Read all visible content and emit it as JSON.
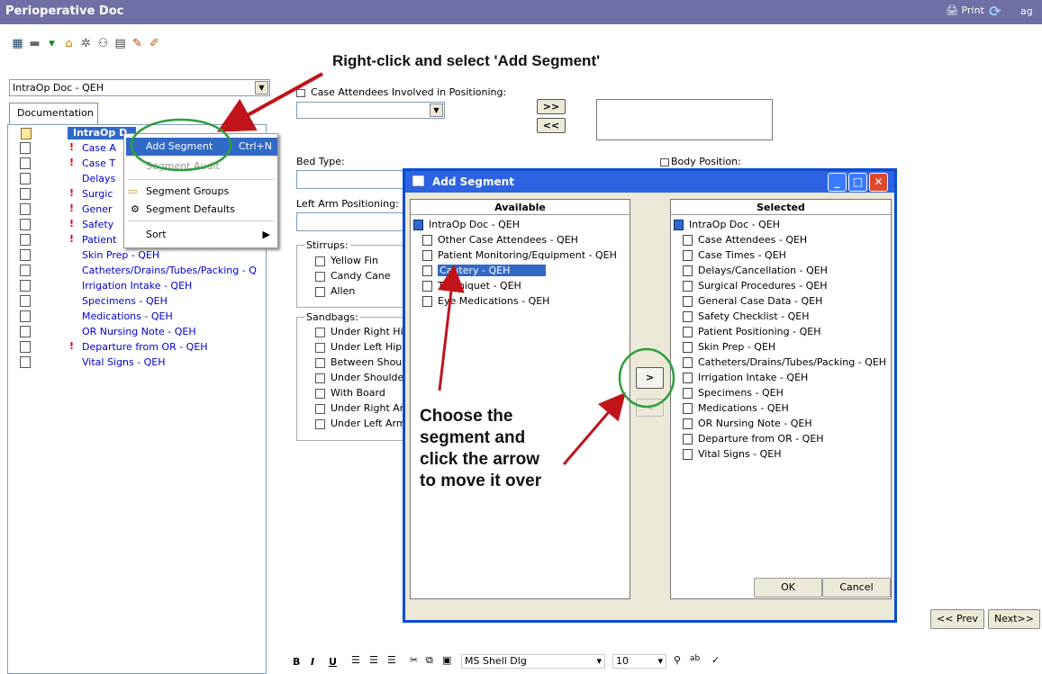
{
  "window": {
    "title": "Perioperative Doc",
    "print_label": "Print",
    "ag_label": "ag"
  },
  "instruction_top": "Right-click and select 'Add Segment'",
  "instruction_bottom": [
    "Choose the",
    "segment and",
    "click the arrow",
    "to move it over"
  ],
  "doc_select": {
    "value": "IntraOp Doc - QEH"
  },
  "tab_label": "Documentation",
  "tree": {
    "root": "IntraOp D",
    "items": [
      {
        "label": "Case A",
        "flag": true
      },
      {
        "label": "Case T",
        "flag": true
      },
      {
        "label": "Delays",
        "flag": false
      },
      {
        "label": "Surgic",
        "flag": true
      },
      {
        "label": "Gener",
        "flag": true
      },
      {
        "label": "Safety",
        "flag": true
      },
      {
        "label": "Patient",
        "flag": true
      },
      {
        "label": "Skin Prep - QEH",
        "flag": false
      },
      {
        "label": "Catheters/Drains/Tubes/Packing - Q",
        "flag": false
      },
      {
        "label": "Irrigation Intake - QEH",
        "flag": false
      },
      {
        "label": "Specimens - QEH",
        "flag": false
      },
      {
        "label": "Medications - QEH",
        "flag": false
      },
      {
        "label": "OR Nursing Note - QEH",
        "flag": false
      },
      {
        "label": "Departure from OR - QEH",
        "flag": true
      },
      {
        "label": "Vital Signs - QEH",
        "flag": false
      }
    ]
  },
  "context_menu": {
    "add_segment": "Add Segment",
    "add_shortcut": "Ctrl+N",
    "segment_audit": "Segment Audit",
    "segment_groups": "Segment Groups",
    "segment_defaults": "Segment Defaults",
    "sort": "Sort"
  },
  "form": {
    "case_attendees_label": "Case Attendees Involved in Positioning:",
    "add_arrow": ">>",
    "remove_arrow": "<<",
    "bed_type_label": "Bed Type:",
    "body_position_label": "Body Position:",
    "left_arm_label": "Left Arm Positioning:",
    "stirrups_label": "Stirrups:",
    "stirrups": [
      "Yellow Fin",
      "Candy Cane",
      "Allen"
    ],
    "sandbags_label": "Sandbags:",
    "sandbags": [
      "Under Right Hip",
      "Under Left Hip",
      "Between Shoul",
      "Under Shoulde",
      "With Board",
      "Under Right Arr",
      "Under Left Arm"
    ]
  },
  "dialog": {
    "title": "Add Segment",
    "available_header": "Available",
    "selected_header": "Selected",
    "available_root": "IntraOp Doc - QEH",
    "available": [
      "Other Case Attendees - QEH",
      "Patient Monitoring/Equipment - QEH",
      "Cautery - QEH",
      "Tourniquet - QEH",
      "Eye Medications - QEH"
    ],
    "available_selected_index": 2,
    "selected_root": "IntraOp Doc - QEH",
    "selected": [
      "Case Attendees - QEH",
      "Case Times - QEH",
      "Delays/Cancellation - QEH",
      "Surgical Procedures - QEH",
      "General Case Data - QEH",
      "Safety Checklist - QEH",
      "Patient Positioning - QEH",
      "Skin Prep - QEH",
      "Catheters/Drains/Tubes/Packing - QEH",
      "Irrigation Intake - QEH",
      "Specimens - QEH",
      "Medications - QEH",
      "OR Nursing Note - QEH",
      "Departure from OR - QEH",
      "Vital Signs - QEH"
    ],
    "move_right": ">",
    "move_left": "<",
    "ok": "OK",
    "cancel": "Cancel"
  },
  "nav": {
    "prev": "<< Prev",
    "next": "Next>>"
  },
  "bottom_toolbar": {
    "bold": "B",
    "italic": "I",
    "underline": "U",
    "font": "MS Shell Dlg",
    "size": "10"
  },
  "colors": {
    "titlebar": "#6f6fa5",
    "highlight": "#3169c6",
    "annotation_circle": "#2e9e3e",
    "annotation_arrow": "#c0141a"
  }
}
